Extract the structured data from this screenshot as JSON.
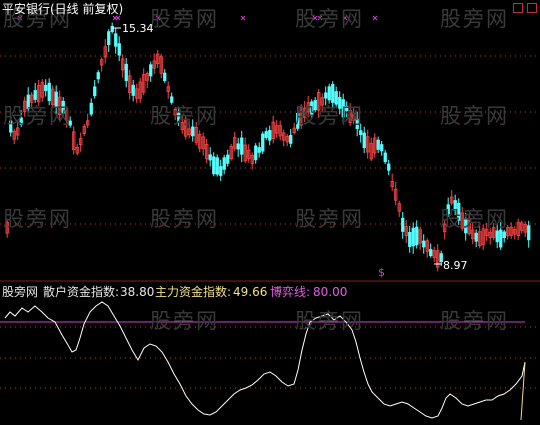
{
  "title": "平安银行(日线 前复权)",
  "price_high_label": "15.34",
  "price_low_label": "8.97",
  "watermark": "股旁网",
  "signal_mark": "$",
  "window_controls": [
    "restore-button",
    "close-button"
  ],
  "indicator": {
    "source_label": "股旁网",
    "retail_label": "散户资金指数:",
    "retail_value": "38.80",
    "main_label": "主力资金指数:",
    "main_value": "49.66",
    "game_label": "博弈线:",
    "game_value": "80.00"
  },
  "colors": {
    "background": "#000000",
    "up": "#ff4545",
    "down": "#54ffff",
    "title": "#ffffff",
    "retail_text": "#e6e6e6",
    "main_text": "#f0e08a",
    "game_text": "#e060e0",
    "game_line": "#d040d0",
    "index_line": "#ffffff",
    "dotted": "#c23030",
    "signal": "#d040d0"
  }
}
